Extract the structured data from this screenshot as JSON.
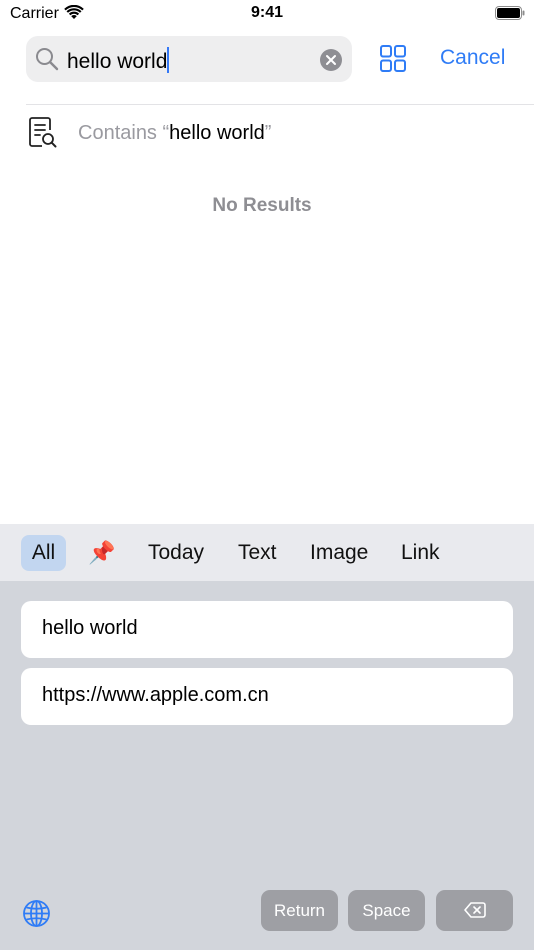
{
  "status": {
    "carrier": "Carrier",
    "time": "9:41"
  },
  "search": {
    "query": "hello world",
    "cancel_label": "Cancel"
  },
  "contains": {
    "label": "Contains ",
    "open_quote": "“",
    "query": "hello world",
    "close_quote": "”"
  },
  "empty_state": "No Results",
  "filters": [
    {
      "label": "All",
      "active": true
    },
    {
      "label": "📌",
      "icon": "pushpin-icon"
    },
    {
      "label": "Today"
    },
    {
      "label": "Text"
    },
    {
      "label": "Image"
    },
    {
      "label": "Link"
    }
  ],
  "clipboard_items": [
    {
      "text": "hello world"
    },
    {
      "text": "https://www.apple.com.cn"
    }
  ],
  "keys": {
    "return_label": "Return",
    "space_label": "Space"
  },
  "colors": {
    "accent": "#2f7cf6",
    "active_filter_bg": "#c2d6f0",
    "keyboard_bg": "#d2d5db",
    "key_bg": "#9e9fa4"
  }
}
